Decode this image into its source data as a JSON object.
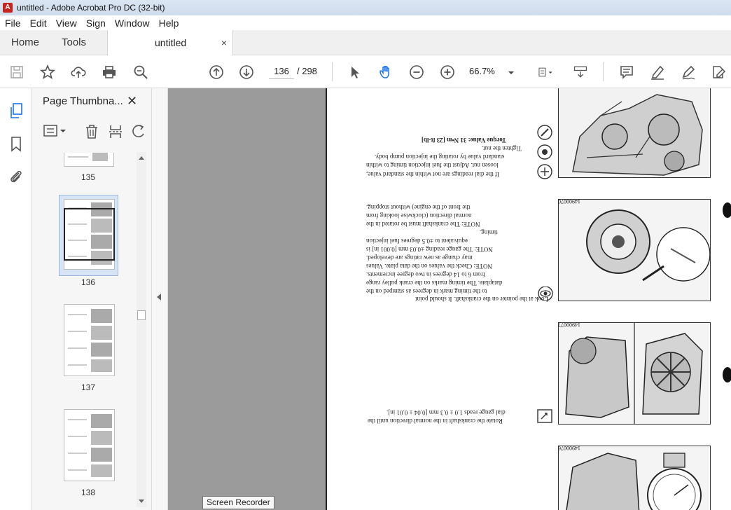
{
  "window": {
    "title": "untitled - Adobe Acrobat Pro DC (32-bit)"
  },
  "menu": [
    "File",
    "Edit",
    "View",
    "Sign",
    "Window",
    "Help"
  ],
  "tabs": {
    "home": "Home",
    "tools": "Tools",
    "document": "untitled",
    "close": "×"
  },
  "toolbar": {
    "current_page": "136",
    "page_total": "/  298",
    "zoom": "66.7%"
  },
  "panel": {
    "title": "Page Thumbna...",
    "close": "✕",
    "thumbnails": [
      {
        "label": "135",
        "selected": false
      },
      {
        "label": "136",
        "selected": true
      },
      {
        "label": "137",
        "selected": false
      },
      {
        "label": "138",
        "selected": false
      }
    ]
  },
  "page_content": {
    "fig_ids": [
      "14900070",
      "14900077",
      "14900076"
    ],
    "paragraphs": [
      "If the dial readings are not within the standard value,",
      "loosen nut. Adjust the fuel injection timing to within",
      "standard value by rotating the injection pump body.",
      "Tighten the nut.",
      "Torque Value:   31 N•m   [23 ft-lb]",
      "NOTE:   The crankshaft must be rotated in the",
      "normal direction (clockwise looking from",
      "the front of the engine) without stopping.",
      "Look at the pointer on the crankshaft. It should point",
      "to the timing mark in degrees as stamped on the",
      "dataplate. The timing marks on the crank pulley range",
      "from 6 to 14 degrees in two degree increments.",
      "NOTE:  Check the values on the data plate. Values",
      "may change as new ratings are developed.",
      "NOTE:  The gauge reading ±0.03 mm [0.001 in] is",
      "equivalent to ±0.5 degrees fuel injection",
      "timing.",
      "Rotate the crankshaft in the normal direction until the",
      "dial gauge reads 1.0 ± 0.3 mm [0.04 ± 0.01 in]."
    ]
  },
  "tooltip": "Screen Recorder"
}
